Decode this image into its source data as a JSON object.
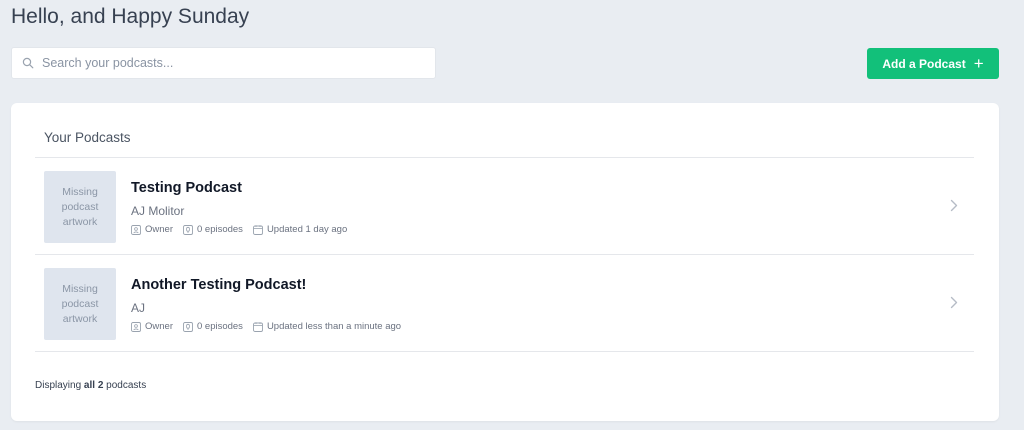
{
  "header": {
    "greeting": "Hello, and Happy Sunday"
  },
  "search": {
    "placeholder": "Search your podcasts...",
    "value": "",
    "icon": "search-icon"
  },
  "toolbar": {
    "add_label": "Add a Podcast",
    "add_icon": "+"
  },
  "podcasts_section": {
    "title": "Your Podcasts",
    "items": [
      {
        "artwork_text": "Missing podcast artwork",
        "title": "Testing Podcast",
        "author": "AJ Molitor",
        "role": "Owner",
        "episodes": "0 episodes",
        "updated": "Updated 1 day ago"
      },
      {
        "artwork_text": "Missing podcast artwork",
        "title": "Another Testing Podcast!",
        "author": "AJ",
        "role": "Owner",
        "episodes": "0 episodes",
        "updated": "Updated less than a minute ago"
      }
    ],
    "footer": {
      "prefix": "Displaying",
      "count": "all 2",
      "suffix": "podcasts"
    }
  },
  "colors": {
    "accent": "#12c07a",
    "background": "#e9edf2",
    "card": "#ffffff"
  }
}
